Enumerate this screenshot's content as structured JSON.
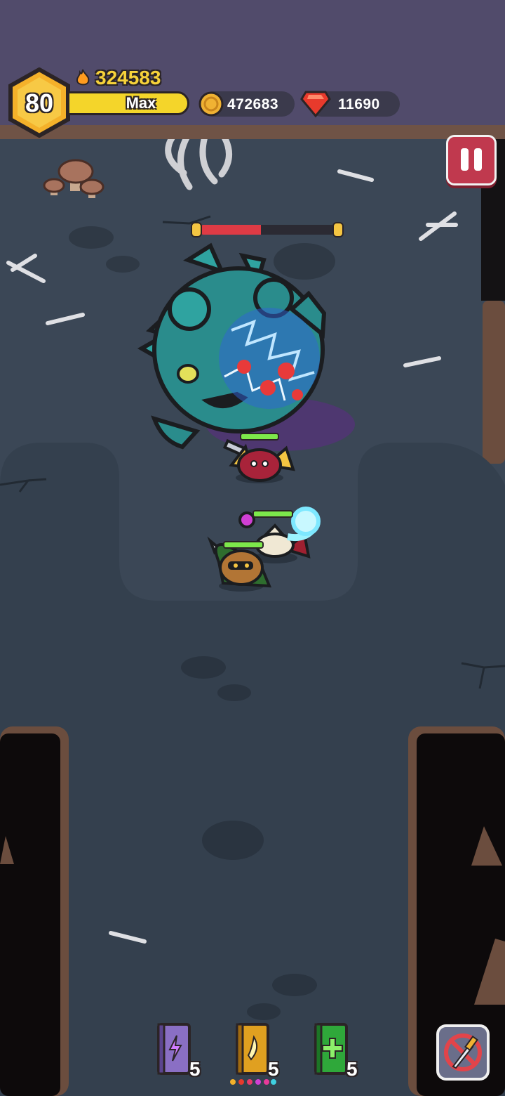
{
  "player": {
    "level": "80",
    "xp_label": "Max",
    "power": "324583"
  },
  "currency": {
    "gold": "472683",
    "gems": "11690"
  },
  "boss": {
    "hp_fraction": 0.45
  },
  "heroes": [
    {
      "name": "spider-hero",
      "hp_fraction": 1.0
    },
    {
      "name": "mage-hero",
      "hp_fraction": 1.0
    },
    {
      "name": "archer-hero",
      "hp_fraction": 1.0
    }
  ],
  "skills": [
    {
      "icon": "lightning-book-icon",
      "count": "5",
      "color": "#8a6fc4"
    },
    {
      "icon": "wind-book-icon",
      "count": "5",
      "color": "#e0a020"
    },
    {
      "icon": "heal-book-icon",
      "count": "5",
      "color": "#2fa83a"
    }
  ],
  "colors": {
    "accent": "#f4d52a",
    "pause": "#c0394e",
    "gem": "#e83a2c",
    "gold": "#f0b233"
  }
}
